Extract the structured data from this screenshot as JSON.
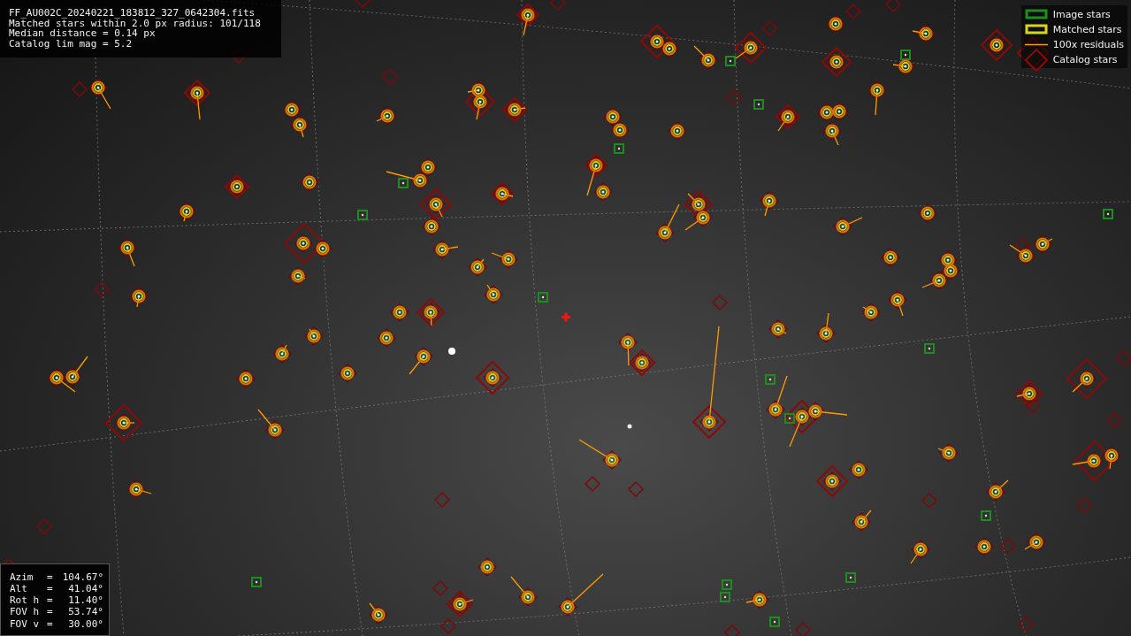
{
  "info": {
    "lines": [
      "FF_AU002C_20240221_183812_327_0642304.fits",
      "Matched stars within 2.0 px radius: 101/118",
      "Median distance = 0.14 px",
      "Catalog lim mag = 5.2"
    ]
  },
  "legend": [
    {
      "kind": "image",
      "label": "Image stars"
    },
    {
      "kind": "matched",
      "label": "Matched stars"
    },
    {
      "kind": "residual",
      "label": "100x residuals"
    },
    {
      "kind": "catalog",
      "label": "Catalog stars"
    }
  ],
  "pointing": [
    {
      "label": "Azim",
      "sign": "=",
      "value": "104.67°"
    },
    {
      "label": "Alt",
      "sign": "=",
      "value": "41.04°"
    },
    {
      "label": "Rot h",
      "sign": "=",
      "value": "11.40°"
    },
    {
      "label": "FOV h",
      "sign": "=",
      "value": "53.74°"
    },
    {
      "label": "FOV v",
      "sign": "=",
      "value": "30.00°"
    }
  ]
}
